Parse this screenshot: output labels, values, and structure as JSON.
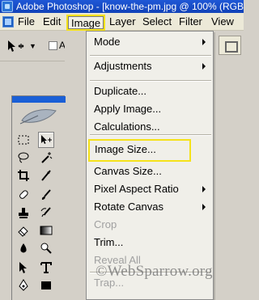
{
  "titlebar": {
    "title": "Adobe Photoshop - [know-the-pm.jpg @ 100% (RGB/"
  },
  "menubar": {
    "items": [
      "File",
      "Edit",
      "Image",
      "Layer",
      "Select",
      "Filter",
      "View"
    ],
    "active_index": 2
  },
  "options": {
    "auto_label": "A"
  },
  "image_menu": {
    "items": [
      {
        "label": "Mode",
        "submenu": true
      },
      {
        "label": "Adjustments",
        "submenu": true
      },
      {
        "label": "Duplicate...",
        "submenu": false
      },
      {
        "label": "Apply Image...",
        "submenu": false
      },
      {
        "label": "Calculations...",
        "submenu": false
      },
      {
        "label": "Image Size...",
        "submenu": false,
        "highlighted": true
      },
      {
        "label": "Canvas Size...",
        "submenu": false
      },
      {
        "label": "Pixel Aspect Ratio",
        "submenu": true
      },
      {
        "label": "Rotate Canvas",
        "submenu": true
      },
      {
        "label": "Crop",
        "submenu": false,
        "disabled": true
      },
      {
        "label": "Trim...",
        "submenu": false
      },
      {
        "label": "Reveal All",
        "submenu": false,
        "disabled": true
      },
      {
        "label": "Trap...",
        "submenu": false,
        "disabled": true
      }
    ]
  },
  "tools": {
    "icons": [
      "marquee-icon",
      "move-icon",
      "lasso-icon",
      "magic-wand-icon",
      "crop-icon",
      "slice-icon",
      "healing-icon",
      "brush-icon",
      "stamp-icon",
      "history-brush-icon",
      "eraser-icon",
      "gradient-icon",
      "blur-icon",
      "dodge-icon",
      "path-select-icon",
      "type-icon",
      "pen-icon",
      "shape-icon"
    ]
  },
  "watermark": "©WebSparrow.org",
  "colors": {
    "titlebar": "#1142b8",
    "highlight": "#f5e21a",
    "menu_bg": "#f0efe9"
  }
}
